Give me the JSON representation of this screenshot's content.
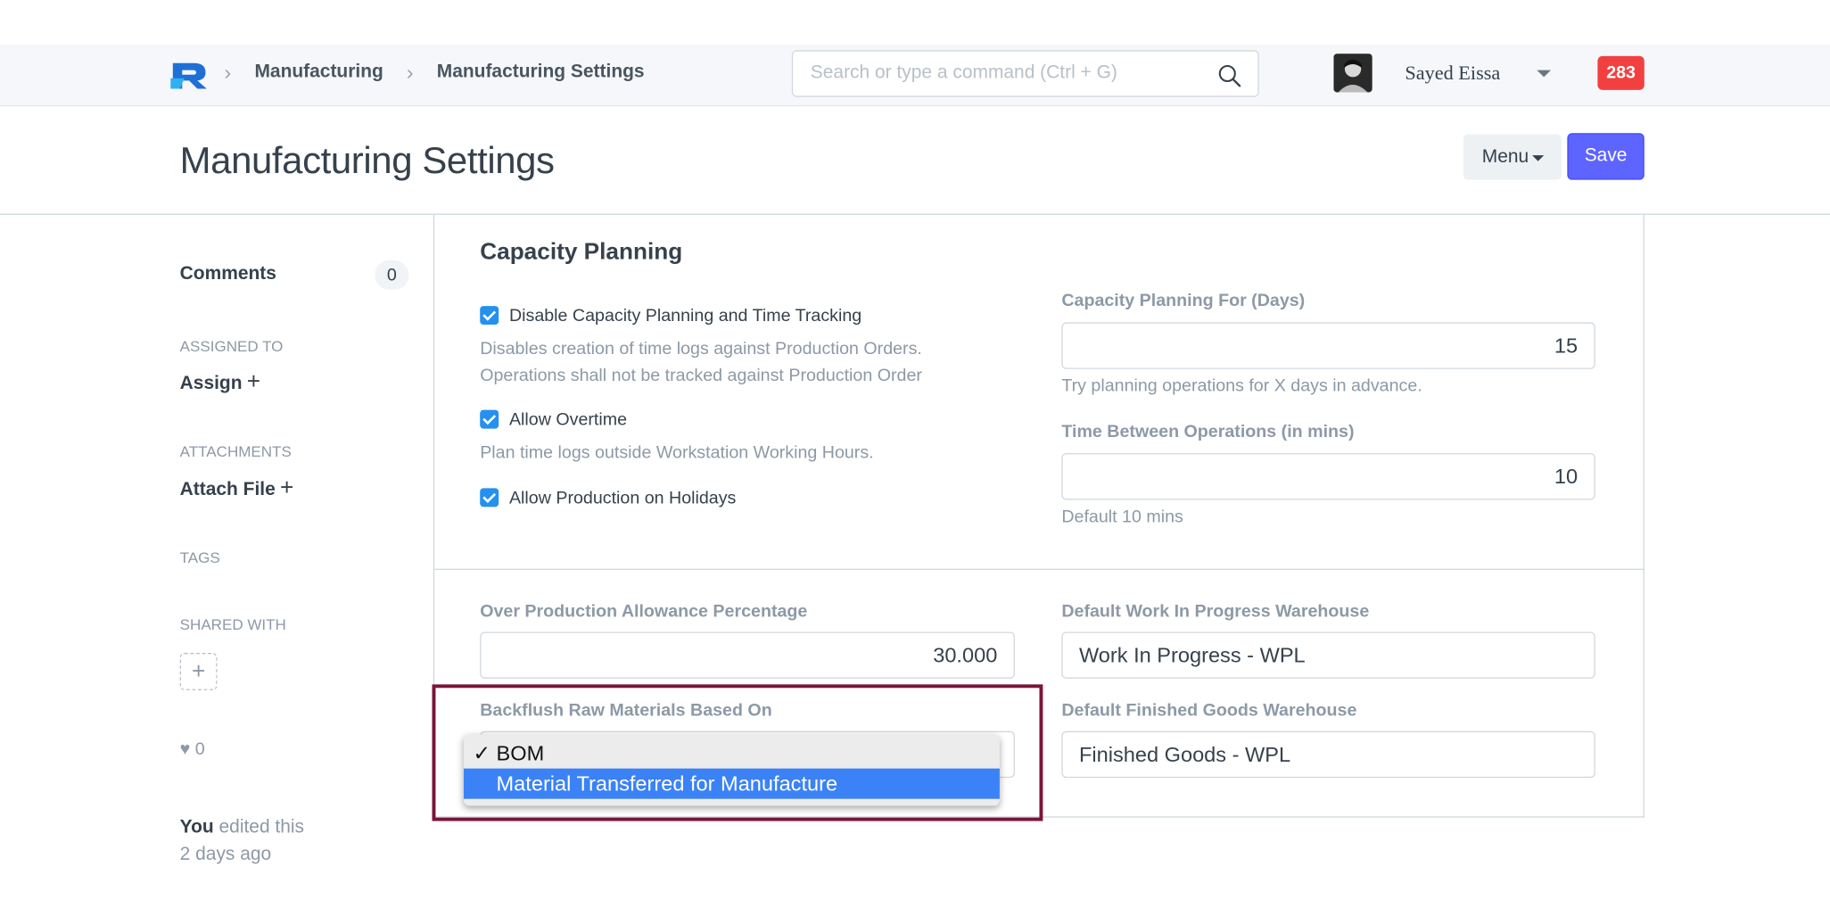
{
  "navbar": {
    "breadcrumbs": [
      "Manufacturing",
      "Manufacturing Settings"
    ],
    "search_placeholder": "Search or type a command (Ctrl + G)",
    "user_name": "Sayed Eissa",
    "notification_count": "283"
  },
  "page": {
    "title": "Manufacturing Settings",
    "menu_label": "Menu",
    "save_label": "Save"
  },
  "sidebar": {
    "comments_label": "Comments",
    "comments_count": "0",
    "assigned_to_label": "ASSIGNED TO",
    "assign_label": "Assign",
    "attachments_label": "ATTACHMENTS",
    "attach_label": "Attach File",
    "tags_label": "TAGS",
    "shared_with_label": "SHARED WITH",
    "likes_count": "0",
    "edit_actor": "You",
    "edit_text": "edited this",
    "edit_time": "2 days ago"
  },
  "capacity": {
    "section_title": "Capacity Planning",
    "disable_capacity_label": "Disable Capacity Planning and Time Tracking",
    "disable_capacity_help_1": "Disables creation of time logs against Production Orders.",
    "disable_capacity_help_2": "Operations shall not be tracked against Production Order",
    "allow_overtime_label": "Allow Overtime",
    "allow_overtime_help": "Plan time logs outside Workstation Working Hours.",
    "allow_holidays_label": "Allow Production on Holidays",
    "planning_days_label": "Capacity Planning For (Days)",
    "planning_days_value": "15",
    "planning_days_help": "Try planning operations for X days in advance.",
    "time_between_label": "Time Between Operations (in mins)",
    "time_between_value": "10",
    "time_between_help": "Default 10 mins"
  },
  "settings": {
    "over_production_label": "Over Production Allowance Percentage",
    "over_production_value": "30.000",
    "wip_warehouse_label": "Default Work In Progress Warehouse",
    "wip_warehouse_value": "Work In Progress - WPL",
    "backflush_label": "Backflush Raw Materials Based On",
    "fg_warehouse_label": "Default Finished Goods Warehouse",
    "fg_warehouse_value": "Finished Goods - WPL",
    "backflush_options": [
      "BOM",
      "Material Transferred for Manufacture"
    ],
    "backflush_checked_mark": "✓"
  },
  "colors": {
    "primary": "#5e64ff",
    "checkbox": "#2490ef",
    "badge": "#f24040",
    "highlight_border": "#7a1438",
    "dropdown_selected": "#3b82f6"
  }
}
